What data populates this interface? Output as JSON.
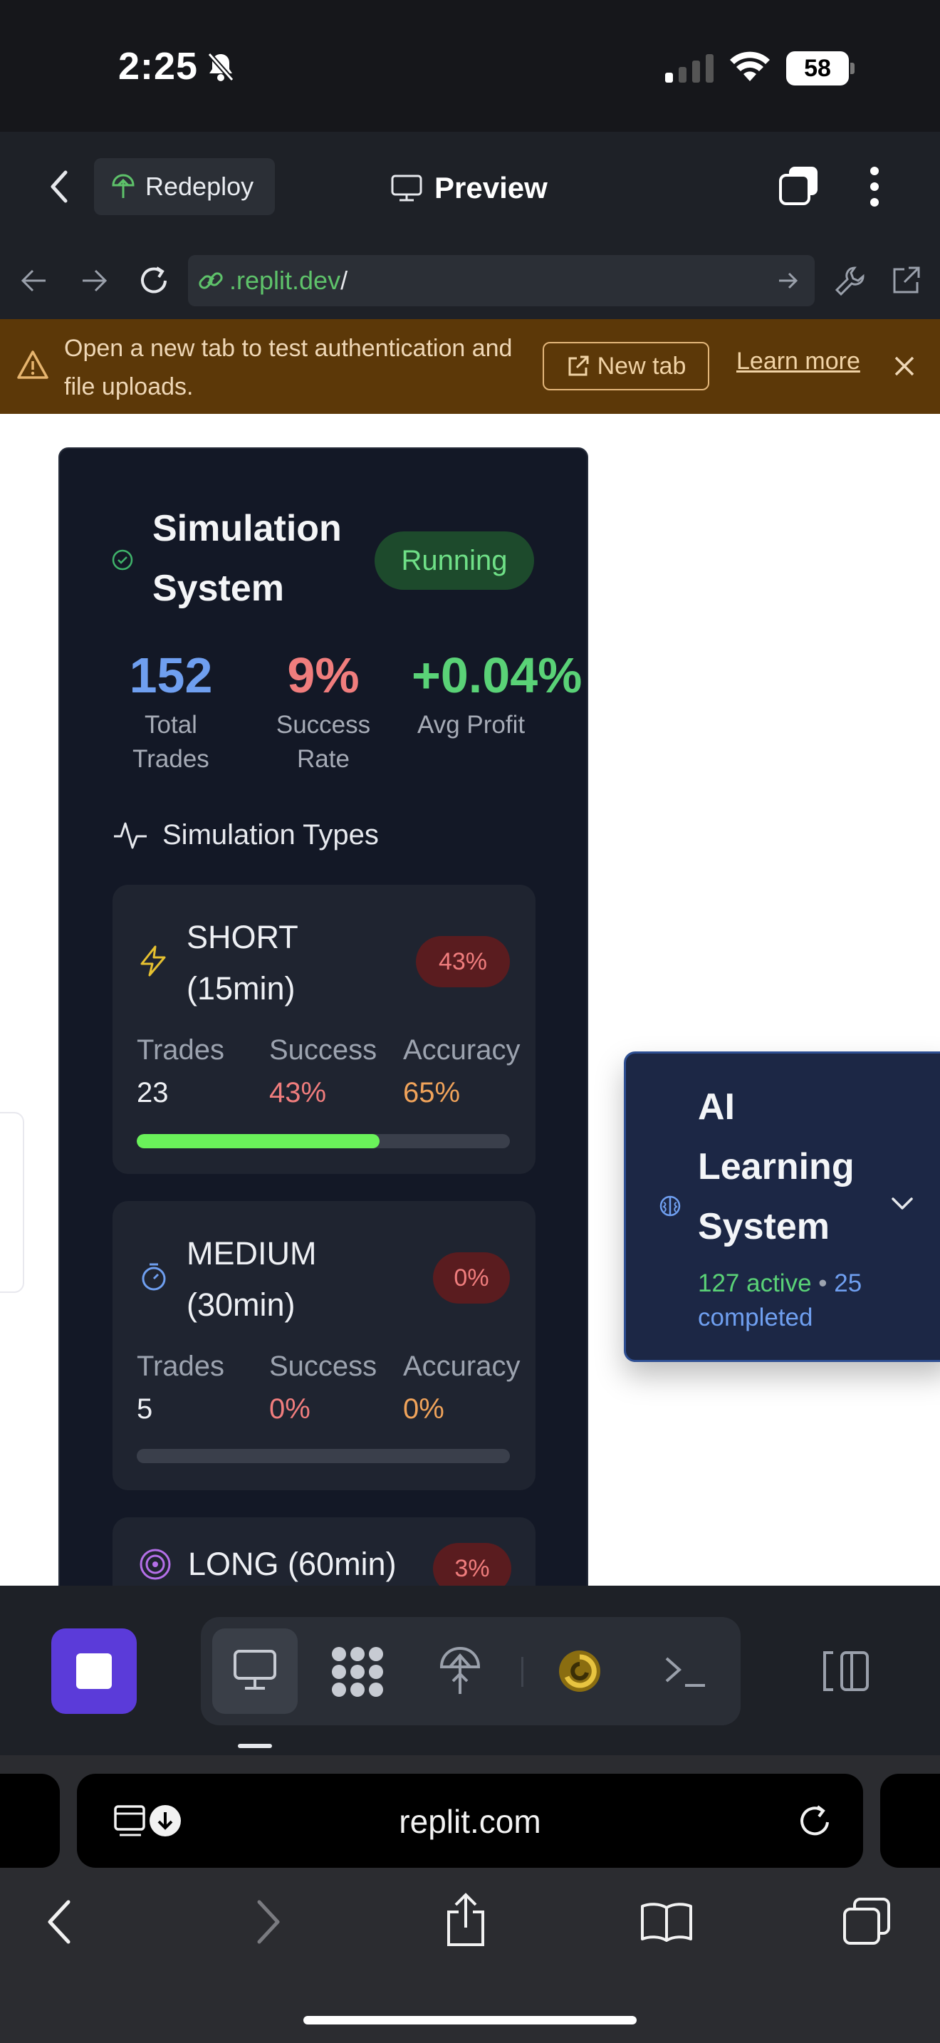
{
  "status_bar": {
    "time": "2:25",
    "battery": "58"
  },
  "header": {
    "redeploy_label": "Redeploy",
    "preview_label": "Preview"
  },
  "url_bar": {
    "url_prefix": ".replit.dev",
    "url_suffix": "/"
  },
  "banner": {
    "text": "Open a new tab to test authentication and file uploads.",
    "new_tab_label": "New tab",
    "learn_more_label": "Learn more"
  },
  "simulation": {
    "title": "Simulation System",
    "status": "Running",
    "stats": [
      {
        "value": "152",
        "label": "Total Trades",
        "color": "#6f9ff0"
      },
      {
        "value": "9%",
        "label": "Success Rate",
        "color": "#f07d7d"
      },
      {
        "value": "+0.04%",
        "label": "Avg Profit",
        "color": "#5ad277"
      }
    ],
    "section_title": "Simulation Types",
    "types": [
      {
        "name": "SHORT (15min)",
        "badge": "43%",
        "trades": "23",
        "success": "43%",
        "accuracy": "65%",
        "progress": 0.65
      },
      {
        "name": "MEDIUM (30min)",
        "badge": "0%",
        "trades": "5",
        "success": "0%",
        "accuracy": "0%",
        "progress": 0
      },
      {
        "name": "LONG (60min)",
        "badge": "3%"
      }
    ],
    "col_labels": {
      "trades": "Trades",
      "success": "Success",
      "accuracy": "Accuracy"
    }
  },
  "ai_learning": {
    "title": "AI Learning System",
    "active": "127 active",
    "separator": "•",
    "completed": "25 completed"
  },
  "safari": {
    "address": "replit.com"
  }
}
